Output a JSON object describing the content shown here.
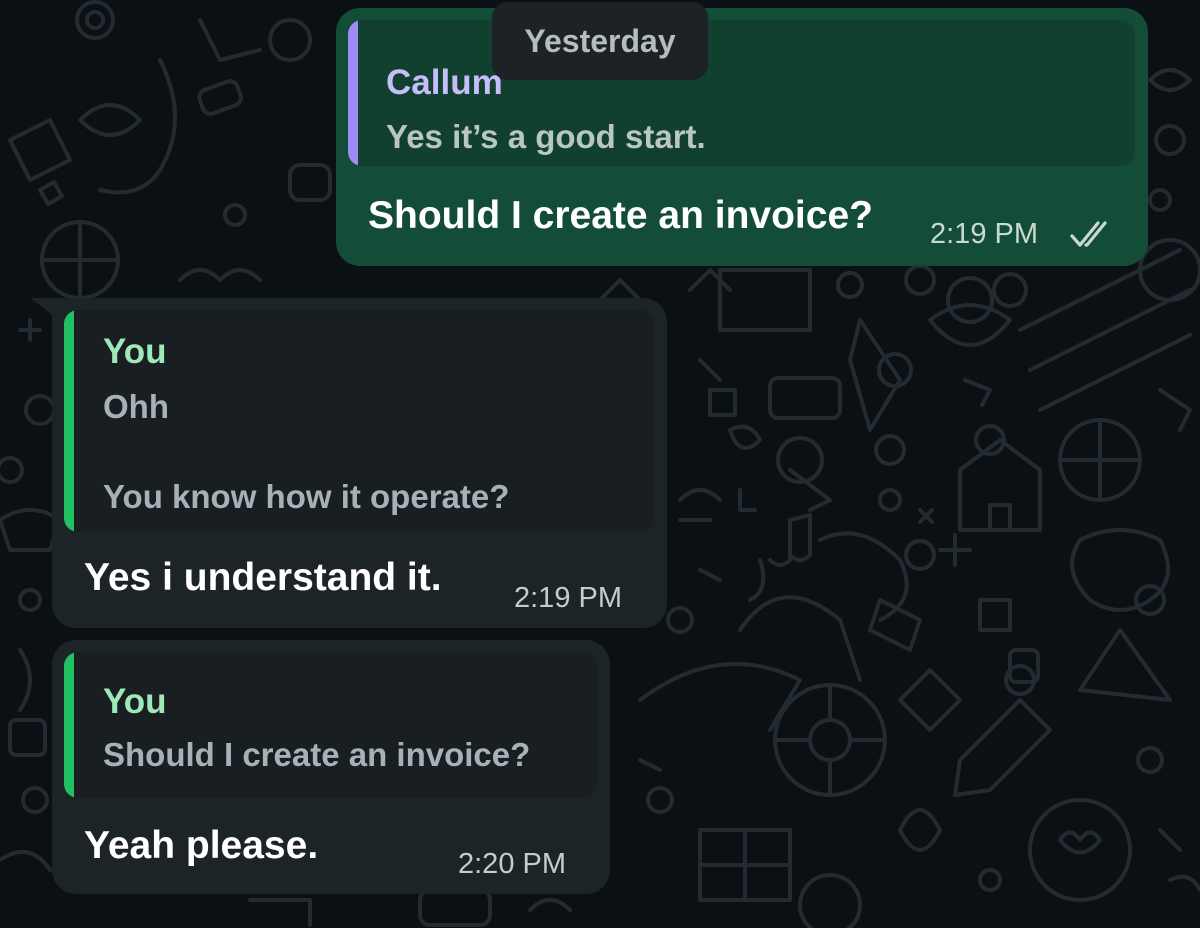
{
  "date_separator": "Yesterday",
  "messages": [
    {
      "direction": "outgoing",
      "quote": {
        "author": "Callum",
        "text": "Yes it’s a good start."
      },
      "text": "Should I create an invoice?",
      "time": "2:19 PM",
      "status_icon": "double-check-icon"
    },
    {
      "direction": "incoming",
      "quote": {
        "author": "You",
        "text_line1": "Ohh",
        "text_line2": "You know how it operate?"
      },
      "text": "Yes i understand it.",
      "time": "2:19 PM"
    },
    {
      "direction": "incoming",
      "quote": {
        "author": "You",
        "text": "Should I create an invoice?"
      },
      "text": "Yeah please.",
      "time": "2:20 PM"
    }
  ],
  "colors": {
    "background": "#0b1014",
    "outgoing_bubble": "#144d37",
    "incoming_bubble": "#1d2428",
    "quote_bar_contact": "#9f8cf5",
    "quote_bar_self": "#21c063",
    "quote_author_contact": "#c7bdfa",
    "quote_author_self": "#9fe8b8"
  }
}
